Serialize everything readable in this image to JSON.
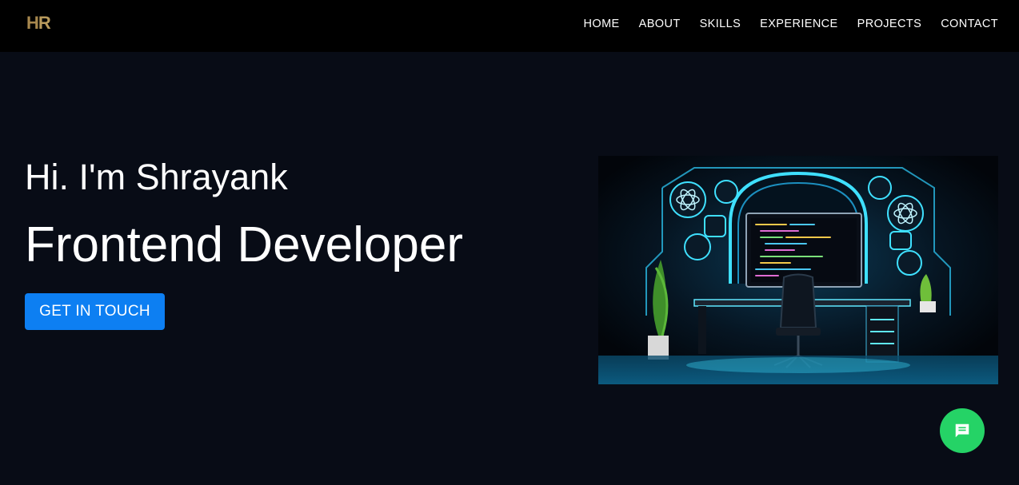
{
  "nav": {
    "logo_text": "HR",
    "links": [
      "HOME",
      "ABOUT",
      "SKILLS",
      "EXPERIENCE",
      "PROJECTS",
      "CONTACT"
    ]
  },
  "hero": {
    "greeting": "Hi. I'm Shrayank",
    "role": "Frontend Developer",
    "cta_label": "GET IN TOUCH",
    "image_icon": "developer-workspace-illustration"
  },
  "chat": {
    "icon": "chat-icon"
  },
  "colors": {
    "background": "#080c16",
    "navbar": "#000000",
    "accent": "#0d7ff2",
    "chat": "#25d366",
    "logo_gold": "#a8884e",
    "neon": "#2fd0ff"
  }
}
